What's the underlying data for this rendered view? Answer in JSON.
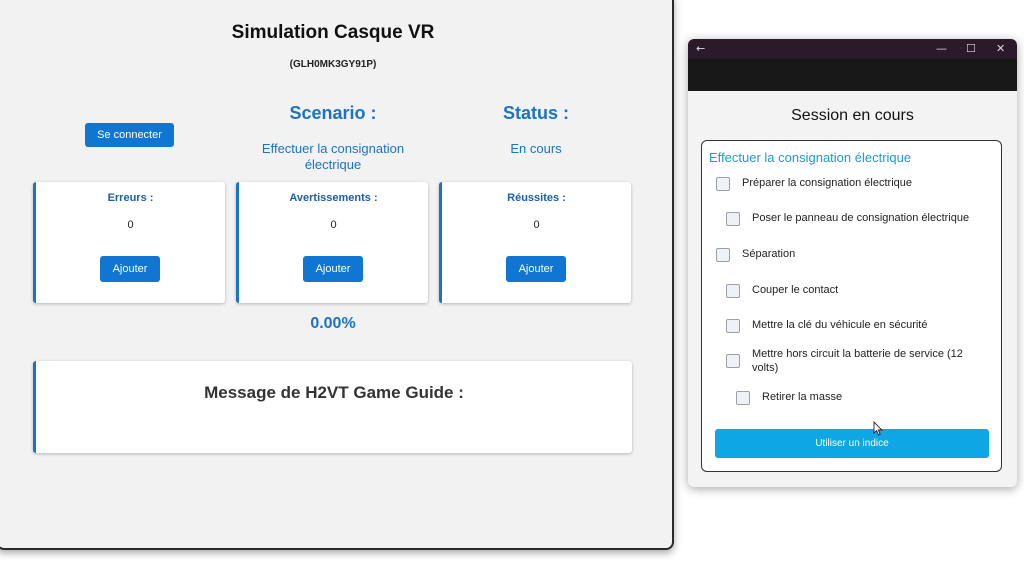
{
  "main": {
    "title": "Simulation Casque VR",
    "device_id": "(GLH0MK3GY91P)",
    "connect_label": "Se connecter",
    "scenario": {
      "heading": "Scenario :",
      "value": "Effectuer la consignation électrique"
    },
    "status": {
      "heading": "Status :",
      "value": "En cours"
    },
    "cards": [
      {
        "label": "Erreurs :",
        "count": "0",
        "button": "Ajouter"
      },
      {
        "label": "Avertissements :",
        "count": "0",
        "button": "Ajouter"
      },
      {
        "label": "Réussites :",
        "count": "0",
        "button": "Ajouter"
      }
    ],
    "progress": "0.00%",
    "message_title": "Message de H2VT Game Guide :"
  },
  "session": {
    "title": "Session en cours",
    "heading": "Effectuer la consignation électrique",
    "tasks": [
      {
        "label": "Préparer la consignation électrique",
        "checked": false
      },
      {
        "label": "Poser le panneau de consignation électrique",
        "checked": false
      },
      {
        "label": "Séparation",
        "checked": false
      },
      {
        "label": "Couper le contact",
        "checked": false
      },
      {
        "label": "Mettre la clé du véhicule en sécurité",
        "checked": false
      },
      {
        "label": "Mettre hors circuit la batterie de service (12 volts)",
        "checked": false
      },
      {
        "label": "Retirer la masse",
        "checked": false
      }
    ],
    "hint_label": "Utiliser un indice"
  },
  "icons": {
    "back": "back-arrow-icon",
    "minimize": "minimize-icon",
    "maximize": "maximize-icon",
    "close": "close-icon",
    "cursor": "mouse-cursor-icon"
  },
  "colors": {
    "accent": "#1a73c4",
    "button": "#0f77d2",
    "hint_button": "#0fa6e6",
    "session_heading": "#1a9bd8",
    "titlebar": "#2a1a2a"
  }
}
